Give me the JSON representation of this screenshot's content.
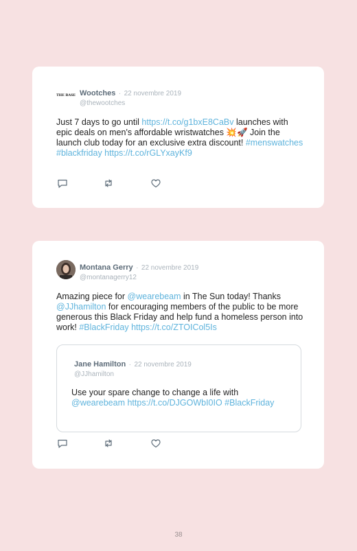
{
  "tweet1": {
    "avatar_text": "THE BASE",
    "name": "Wootches",
    "separator": "·",
    "date": "22 novembre 2019",
    "handle": "@thewootches",
    "text_1": "Just 7 days to go until ",
    "link_1": "https://t.co/g1bxE8CaBv",
    "text_2": " launches with epic deals on men's affordable wristwatches 💥🚀 Join the launch club today for an exclusive extra discount! ",
    "link_2": "#menswatches #blackfriday https://t.co/rGLYxayKf9"
  },
  "tweet2": {
    "name": "Montana Gerry",
    "separator": "·",
    "date": "22 novembre 2019",
    "handle": "@montanagerry12",
    "text_1": "Amazing piece for ",
    "link_1": "@wearebeam",
    "text_2": " in The Sun today! Thanks ",
    "link_2": "@JJhamilton",
    "text_3": " for encouraging members of the public to be more generous this Black Friday and help fund a homeless person into work! ",
    "link_3": "#BlackFriday https://t.co/ZTOICol5Is",
    "quoted": {
      "name": "Jane Hamilton",
      "separator": "·",
      "date": "22 novembre 2019",
      "handle": "@JJhamilton",
      "text_1": "Use your spare change to change a life with ",
      "link_1": "@wearebeam https://t.co/DJGOWbI0IO #BlackFriday"
    }
  },
  "icons": {
    "reply": "reply-icon",
    "retweet": "retweet-icon",
    "like": "heart-icon"
  },
  "colors": {
    "background": "#f7e1e2",
    "link": "#5eb3dc",
    "name": "#5c6b78",
    "muted": "#aab3bb"
  },
  "page_number": "38"
}
